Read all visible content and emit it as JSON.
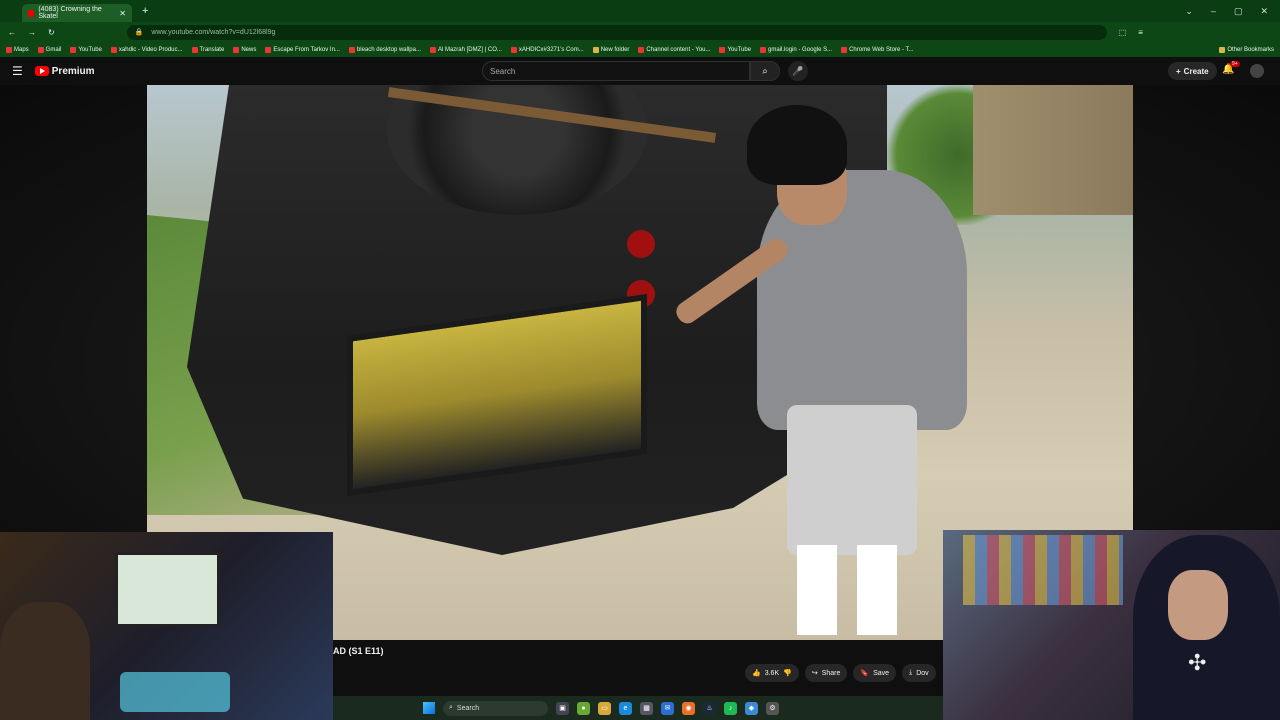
{
  "browser": {
    "tab_title": "(4083) Crowning the Skatel",
    "url": "www.youtube.com/watch?v=dU12l68l9g",
    "window_controls": [
      "⌄",
      "–",
      "▢",
      "✕"
    ],
    "new_tab": "+"
  },
  "bookmarks": {
    "items": [
      "Maps",
      "Gmail",
      "YouTube",
      "xahdic - Video Produc...",
      "Translate",
      "News",
      "Escape From Tarkov In...",
      "bleach desktop wallpa...",
      "Al Mazrah [DMZ] | CO...",
      "xAHDICx#3271's Com...",
      "New folder",
      "Channel content - You...",
      "YouTube",
      "gmail.login - Google S...",
      "Chrome Web Store - T..."
    ],
    "other": "Other Bookmarks"
  },
  "youtube": {
    "logo": "Premium",
    "search_placeholder": "Search",
    "create": "Create",
    "notif_badge": "9+"
  },
  "video": {
    "title_fragment": "AD (S1 E11)",
    "likes": "3.6K",
    "share": "Share",
    "save": "Save",
    "download": "Dov"
  },
  "taskbar": {
    "search": "Search"
  },
  "icons": [
    "menu-icon",
    "search-icon",
    "mic-icon",
    "bell-icon",
    "thumb-up-icon",
    "thumb-down-icon",
    "share-icon",
    "save-icon",
    "download-icon",
    "windows-icon"
  ]
}
